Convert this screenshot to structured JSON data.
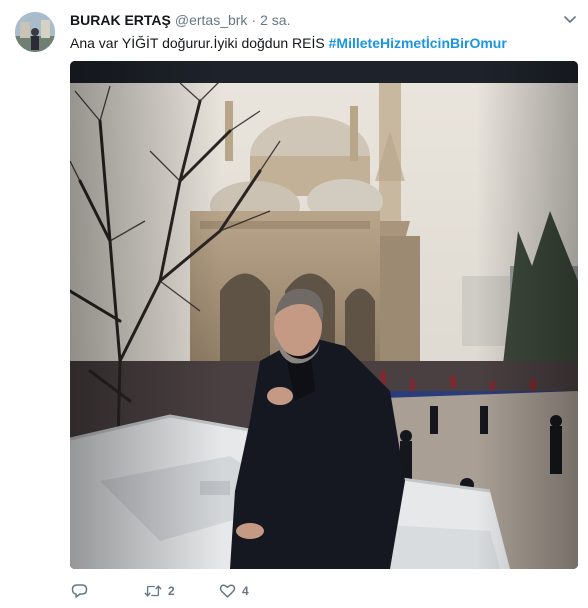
{
  "tweet": {
    "author": {
      "name": "BURAK ERTAŞ",
      "handle": "@ertas_brk",
      "separator": "·",
      "time": "2 sa."
    },
    "text": {
      "body": "Ana var YİĞİT doğurur.İyiki doğdun REİS ",
      "hashtag": "#MilleteHizmetİcinBirOmur"
    },
    "media": {
      "kind": "photo"
    },
    "actions": {
      "reply_icon": "reply-icon",
      "reply_count": "",
      "retweet_icon": "retweet-icon",
      "retweet_count": "2",
      "like_icon": "heart-icon",
      "like_count": "4"
    },
    "colors": {
      "link": "#1b95e0",
      "secondary_text": "#657786",
      "primary_text": "#14171a"
    }
  }
}
